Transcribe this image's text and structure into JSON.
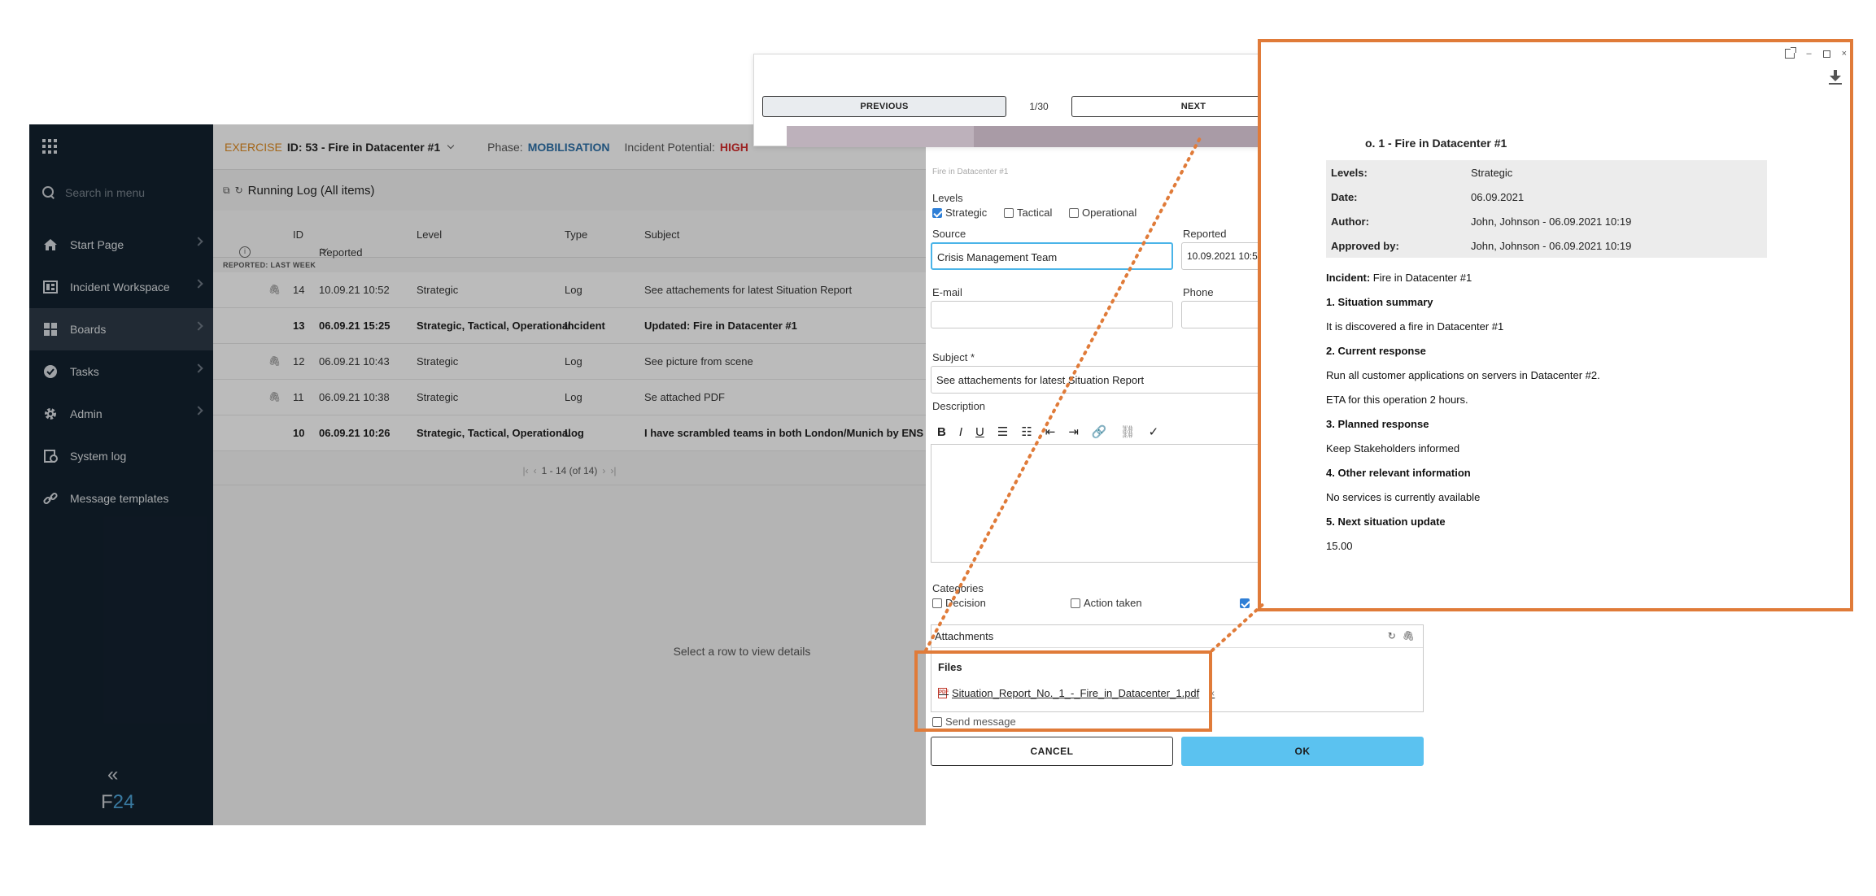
{
  "app": {
    "logo_prefix": "F",
    "logo_suffix": "24",
    "collapse_glyph": "«"
  },
  "sidebar": {
    "search_placeholder": "Search in menu",
    "items": [
      {
        "label": "Start Page",
        "icon": "home-icon"
      },
      {
        "label": "Incident Workspace",
        "icon": "workspace-icon"
      },
      {
        "label": "Boards",
        "icon": "boards-icon",
        "active": true
      },
      {
        "label": "Tasks",
        "icon": "check-circle-icon"
      },
      {
        "label": "Admin",
        "icon": "gear-icon"
      },
      {
        "label": "System log",
        "icon": "system-log-icon"
      },
      {
        "label": "Message templates",
        "icon": "link-icon"
      }
    ]
  },
  "header": {
    "exercise": "EXERCISE",
    "incident": "ID: 53 - Fire in Datacenter #1",
    "phase_label": "Phase:",
    "phase_value": "MOBILISATION",
    "potential_label": "Incident Potential:",
    "potential_value": "HIGH"
  },
  "log": {
    "title": "Running Log (All items)",
    "columns": {
      "id": "ID",
      "reported": "Reported",
      "level": "Level",
      "type": "Type",
      "subject": "Subject"
    },
    "group_label": "REPORTED: LAST WEEK",
    "rows": [
      {
        "id": "14",
        "reported": "10.09.21 10:52",
        "level": "Strategic",
        "type": "Log",
        "subject": "See attachements for latest Situation Report",
        "attachment": true,
        "bold": false
      },
      {
        "id": "13",
        "reported": "06.09.21 15:25",
        "level": "Strategic, Tactical, Operational",
        "type": "Incident",
        "subject": "Updated: Fire in Datacenter #1",
        "attachment": false,
        "bold": true
      },
      {
        "id": "12",
        "reported": "06.09.21 10:43",
        "level": "Strategic",
        "type": "Log",
        "subject": "See picture from scene",
        "attachment": true,
        "bold": false
      },
      {
        "id": "11",
        "reported": "06.09.21 10:38",
        "level": "Strategic",
        "type": "Log",
        "subject": "Se attached PDF",
        "attachment": true,
        "bold": false
      },
      {
        "id": "10",
        "reported": "06.09.21 10:26",
        "level": "Strategic, Tactical, Operational",
        "type": "Log",
        "subject": "I have scrambled teams in both London/Munich by ENS ala",
        "attachment": false,
        "bold": true
      }
    ],
    "pager": "1 - 14 (of 14)",
    "empty_state": "Select a row to view details"
  },
  "form": {
    "incident_hint": "Fire in Datacenter #1",
    "levels_label": "Levels",
    "levels": [
      {
        "label": "Strategic",
        "checked": true
      },
      {
        "label": "Tactical",
        "checked": false
      },
      {
        "label": "Operational",
        "checked": false
      }
    ],
    "source_label": "Source",
    "source_value": "Crisis Management Team",
    "reported_label": "Reported",
    "reported_value": "10.09.2021 10:5",
    "email_label": "E-mail",
    "phone_label": "Phone",
    "subject_label": "Subject *",
    "subject_value": "See attachements for latest Situation Report",
    "description_label": "Description",
    "toolbar": {
      "bold": "B",
      "italic": "I",
      "underline": "U"
    },
    "categories_label": "Categories",
    "categories": [
      {
        "label": "Decision",
        "checked": false
      },
      {
        "label": "Action taken",
        "checked": false
      }
    ],
    "attachments_label": "Attachments",
    "files_label": "Files",
    "file_name": "Situation_Report_No._1_-_Fire_in_Datacenter_1.pdf",
    "send_message_label": "Send message",
    "cancel_label": "CANCEL",
    "ok_label": "OK"
  },
  "viewer": {
    "previous_label": "PREVIOUS",
    "page_count": "1/30",
    "next_label": "NEXT"
  },
  "document": {
    "title": "o. 1 - Fire in Datacenter #1",
    "meta": [
      {
        "key": "Levels:",
        "value": "Strategic"
      },
      {
        "key": "Date:",
        "value": "06.09.2021"
      },
      {
        "key": "Author:",
        "value": "John, Johnson - 06.09.2021 10:19"
      },
      {
        "key": "Approved by:",
        "value": "John, Johnson - 06.09.2021 10:19"
      }
    ],
    "incident_label": "Incident:",
    "incident_value": "Fire in Datacenter #1",
    "s1_heading": "1. Situation summary",
    "s1_text": "It is discovered a fire in Datacenter #1",
    "s2_heading": "2. Current response",
    "s2_text_1": "Run all customer applications on servers in Datacenter #2.",
    "s2_text_2": "ETA for this operation 2 hours.",
    "s3_heading": "3. Planned response",
    "s3_text": "Keep Stakeholders informed",
    "s4_heading": "4. Other relevant information",
    "s4_text": "No services is currently available",
    "s5_heading": "5. Next situation update",
    "s5_text": "15.00"
  },
  "colors": {
    "highlight": "#e07b39",
    "sidebar_bg": "#0f1e2c",
    "accent_blue": "#5bc2f0",
    "exercise_orange": "#e08a1e",
    "potential_red": "#d42b2b"
  }
}
